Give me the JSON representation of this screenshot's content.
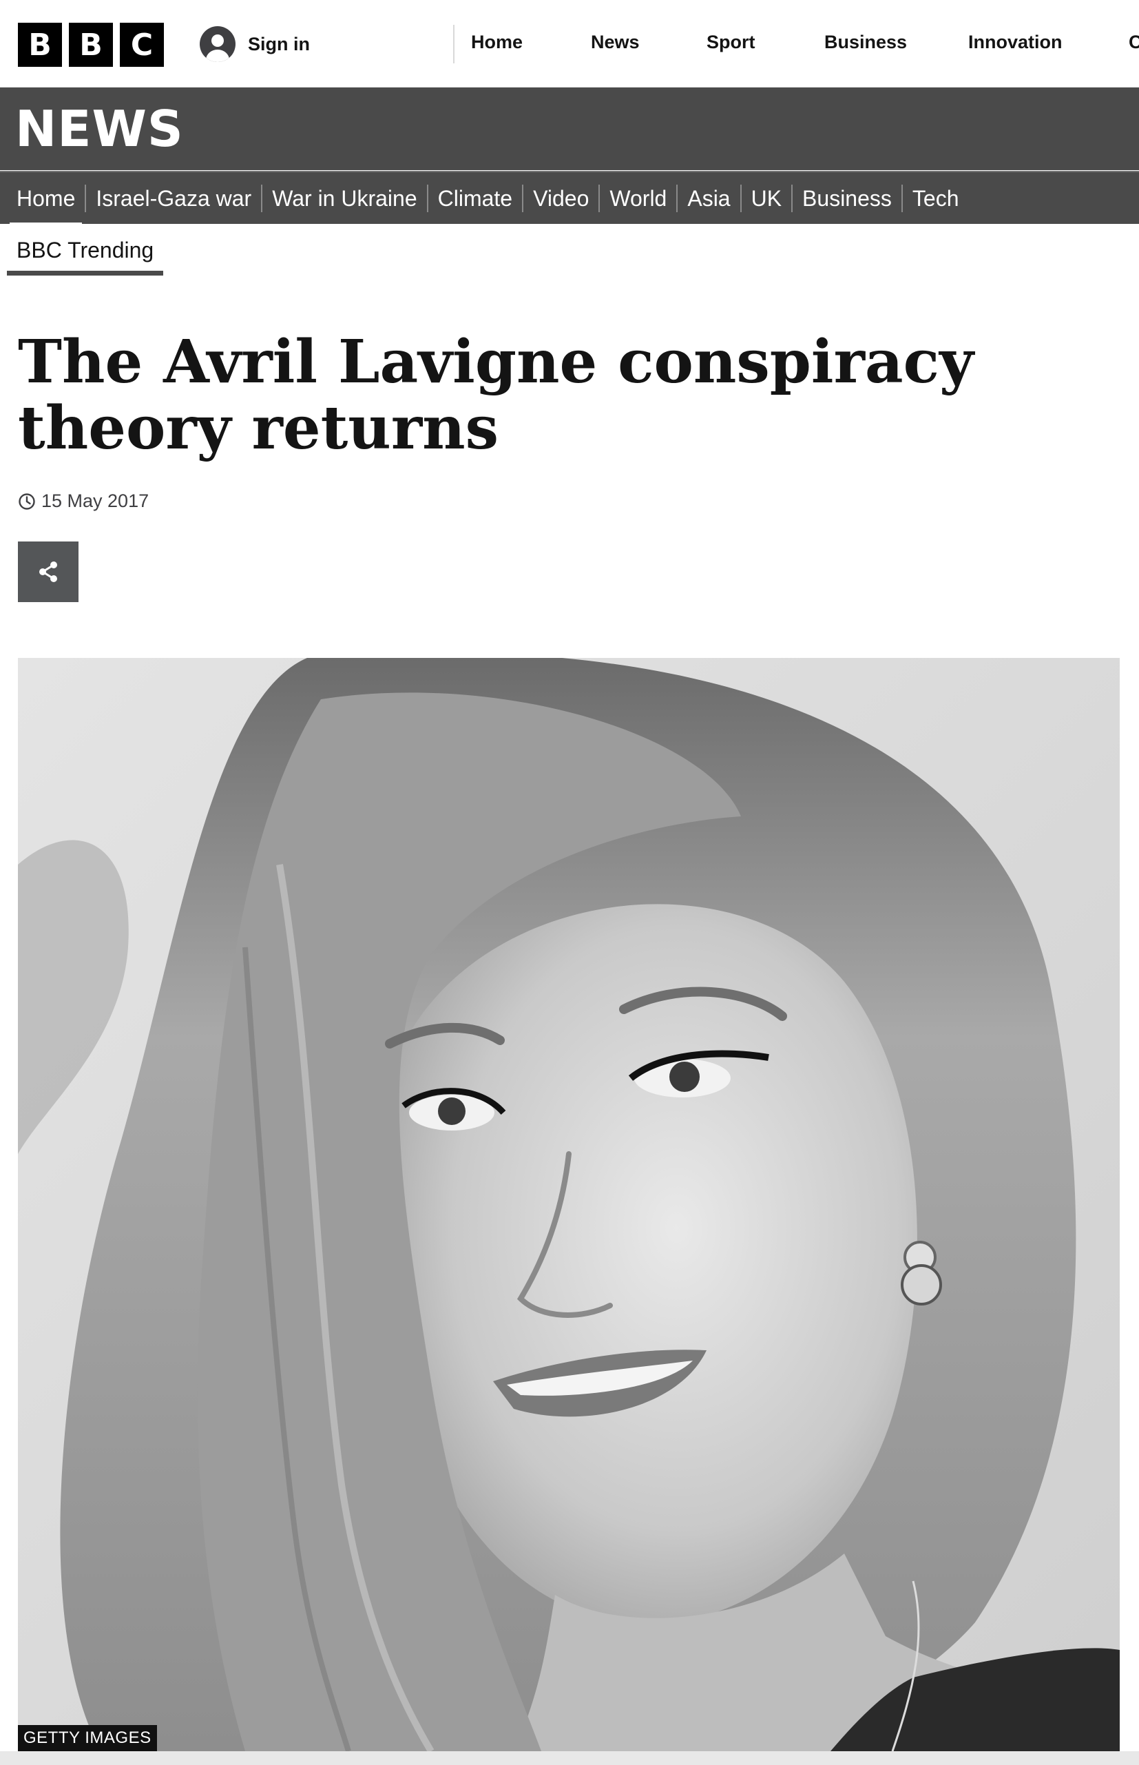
{
  "header": {
    "logo_letters": [
      "B",
      "B",
      "C"
    ],
    "sign_in_label": "Sign in",
    "nav_items": [
      "Home",
      "News",
      "Sport",
      "Business",
      "Innovation",
      "C"
    ]
  },
  "banner": {
    "title": "NEWS"
  },
  "section_nav": {
    "items": [
      "Home",
      "Israel-Gaza war",
      "War in Ukraine",
      "Climate",
      "Video",
      "World",
      "Asia",
      "UK",
      "Business",
      "Tech"
    ]
  },
  "sub_nav": {
    "label": "BBC Trending"
  },
  "article": {
    "headline": "The Avril Lavigne conspiracy theory returns",
    "date": "15 May 2017",
    "image_credit": "GETTY IMAGES"
  },
  "colors": {
    "banner": "#4a4a4a",
    "text": "#141414",
    "share_button": "#545658"
  },
  "icons": {
    "avatar": "user-avatar-icon",
    "clock": "clock-icon",
    "share": "share-icon"
  }
}
